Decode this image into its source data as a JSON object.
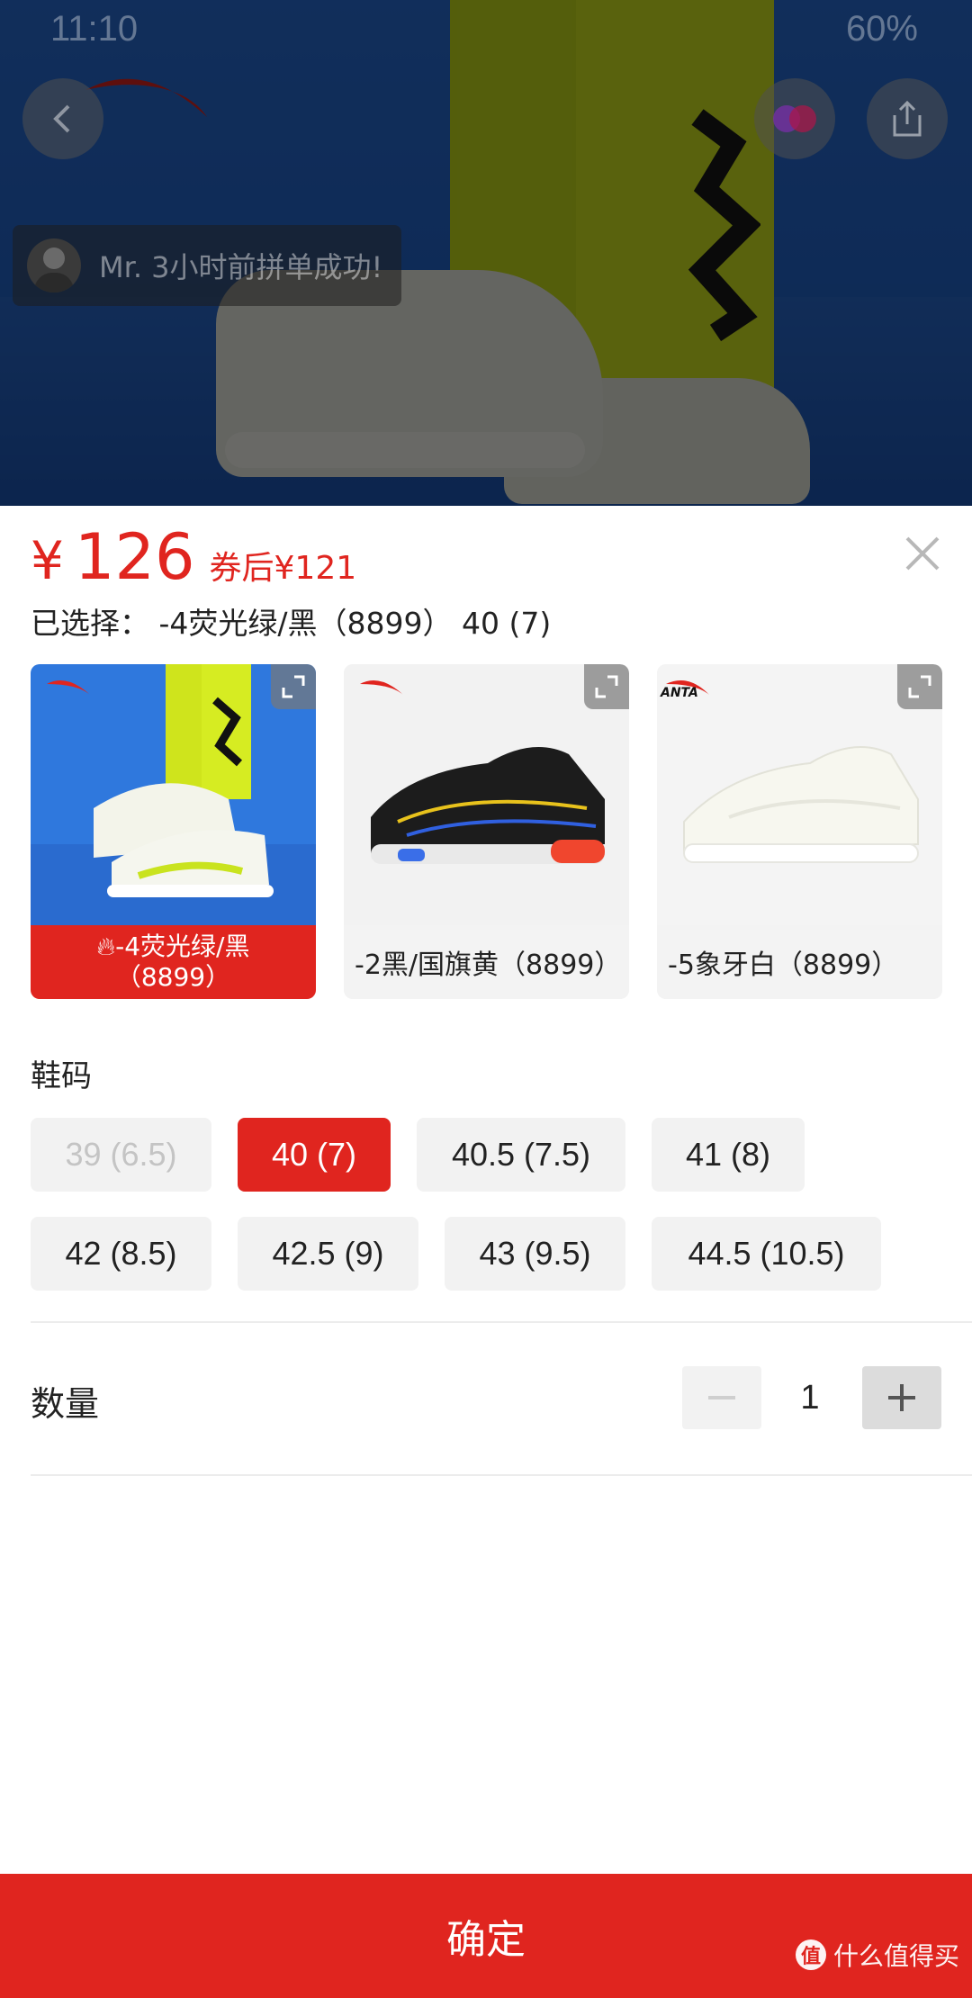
{
  "status_bar": {
    "time": "11:10",
    "battery": "60%"
  },
  "toast": {
    "text": "Mr. 3小时前拼单成功!"
  },
  "price": {
    "currency": "¥",
    "amount": "126",
    "coupon_price": "券后¥121"
  },
  "selected": {
    "text": "已选择： -4荧光绿/黑（8899） 40 (7)"
  },
  "variants": [
    {
      "label_line1": "-4荧光绿/黑",
      "label_line2": "（8899）",
      "active": true
    },
    {
      "label": "-2黑/国旗黄（8899）",
      "active": false
    },
    {
      "label": "-5象牙白（8899）",
      "active": false
    }
  ],
  "variant_brand_text": "ANTA",
  "size_section": {
    "title": "鞋码",
    "sizes": [
      {
        "label": "39 (6.5)",
        "state": "disabled"
      },
      {
        "label": "40 (7)",
        "state": "selected"
      },
      {
        "label": "40.5 (7.5)",
        "state": "normal"
      },
      {
        "label": "41 (8)",
        "state": "normal"
      },
      {
        "label": "42 (8.5)",
        "state": "normal"
      },
      {
        "label": "42.5 (9)",
        "state": "normal"
      },
      {
        "label": "43 (9.5)",
        "state": "normal"
      },
      {
        "label": "44.5 (10.5)",
        "state": "normal"
      }
    ]
  },
  "quantity": {
    "label": "数量",
    "value": "1"
  },
  "confirm_button": "确定",
  "watermark": {
    "text": "什么值得买",
    "badge": "值"
  },
  "colors": {
    "accent": "#e0251f",
    "chip_bg": "#f2f2f2",
    "disabled_text": "#c4c4c4"
  }
}
